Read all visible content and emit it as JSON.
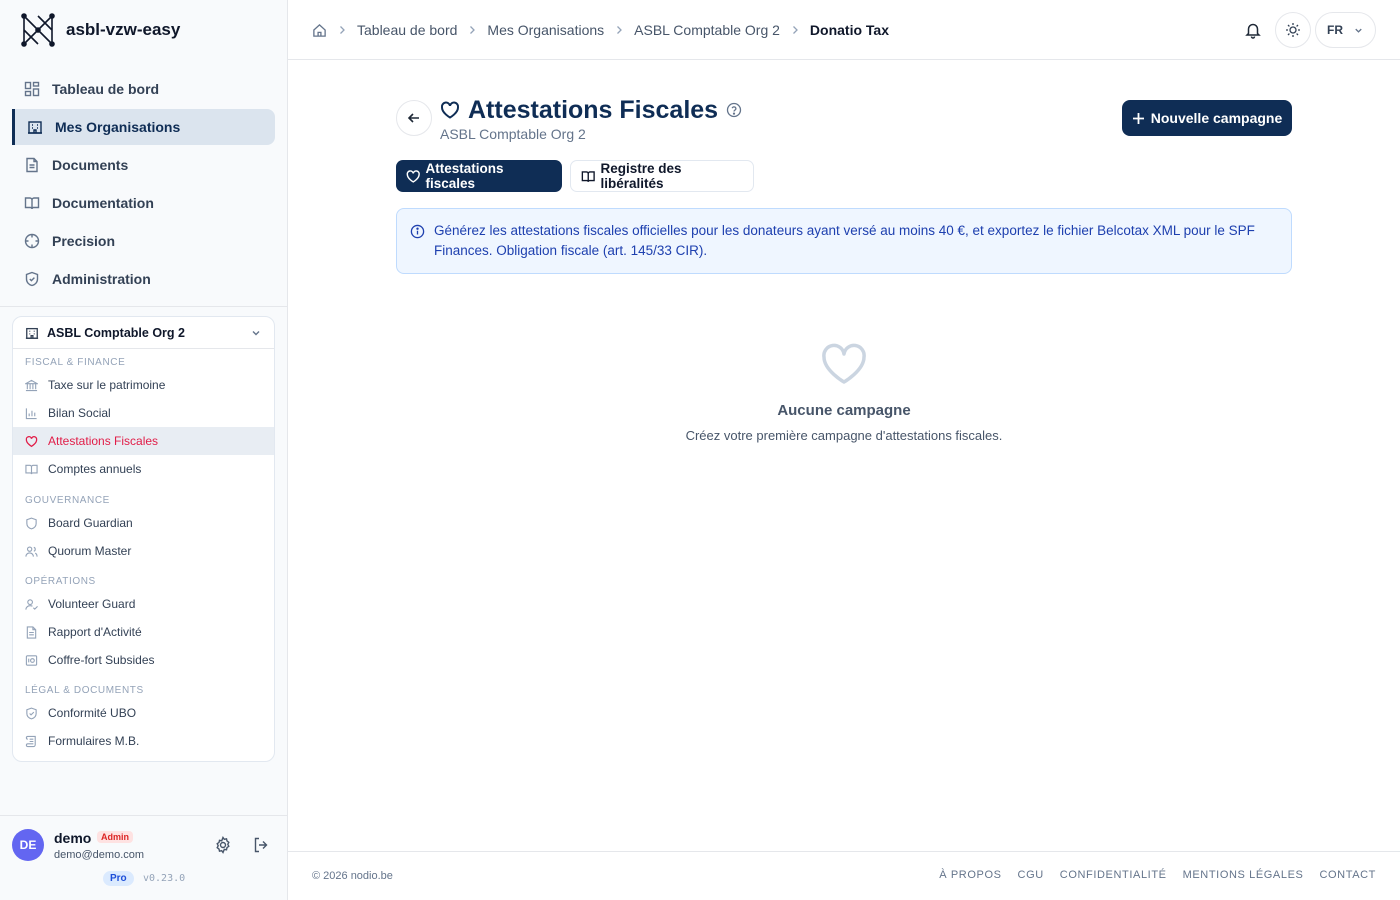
{
  "brand": {
    "name": "asbl-vzw-easy"
  },
  "nav": {
    "items": [
      {
        "label": "Tableau de bord",
        "icon": "dashboard-icon"
      },
      {
        "label": "Mes Organisations",
        "icon": "building-icon"
      },
      {
        "label": "Documents",
        "icon": "file-icon"
      },
      {
        "label": "Documentation",
        "icon": "book-icon"
      },
      {
        "label": "Precision",
        "icon": "crosshair-icon"
      },
      {
        "label": "Administration",
        "icon": "shield-icon"
      }
    ],
    "active": "Mes Organisations"
  },
  "org": {
    "name": "ASBL Comptable Org 2",
    "sections": [
      {
        "label": "FISCAL & FINANCE",
        "items": [
          "Taxe sur le patrimoine",
          "Bilan Social",
          "Attestations Fiscales",
          "Comptes annuels"
        ]
      },
      {
        "label": "GOUVERNANCE",
        "items": [
          "Board Guardian",
          "Quorum Master"
        ]
      },
      {
        "label": "OPÉRATIONS",
        "items": [
          "Volunteer Guard",
          "Rapport d'Activité",
          "Coffre-fort Subsides"
        ]
      },
      {
        "label": "LÉGAL & DOCUMENTS",
        "items": [
          "Conformité UBO",
          "Formulaires M.B."
        ]
      }
    ],
    "active_item": "Attestations Fiscales"
  },
  "user": {
    "initials": "DE",
    "name": "demo",
    "role": "Admin",
    "email": "demo@demo.com",
    "plan": "Pro",
    "version": "v0.23.0"
  },
  "breadcrumb": [
    "Tableau de bord",
    "Mes Organisations",
    "ASBL Comptable Org 2",
    "Donatio Tax"
  ],
  "topbar": {
    "language": "FR"
  },
  "page": {
    "title": "Attestations Fiscales",
    "subtitle": "ASBL Comptable Org 2",
    "primary_action": "Nouvelle campagne",
    "tabs": [
      {
        "label": "Attestations fiscales",
        "active": true
      },
      {
        "label": "Registre des libéralités",
        "active": false
      }
    ],
    "info_text": "Générez les attestations fiscales officielles pour les donateurs ayant versé au moins 40 €, et exportez le fichier Belcotax XML pour le SPF Finances. Obligation fiscale (art. 145/33 CIR).",
    "empty_title": "Aucune campagne",
    "empty_description": "Créez votre première campagne d'attestations fiscales."
  },
  "footer": {
    "copyright": "© 2026 nodio.be",
    "links": [
      "À PROPOS",
      "CGU",
      "CONFIDENTIALITÉ",
      "MENTIONS LÉGALES",
      "CONTACT"
    ]
  },
  "colors": {
    "primary": "#0f2d55",
    "active_sub": "#e11d48",
    "info_bg": "#eff6ff",
    "info_text": "#1e40af",
    "avatar": "#6366f1"
  }
}
